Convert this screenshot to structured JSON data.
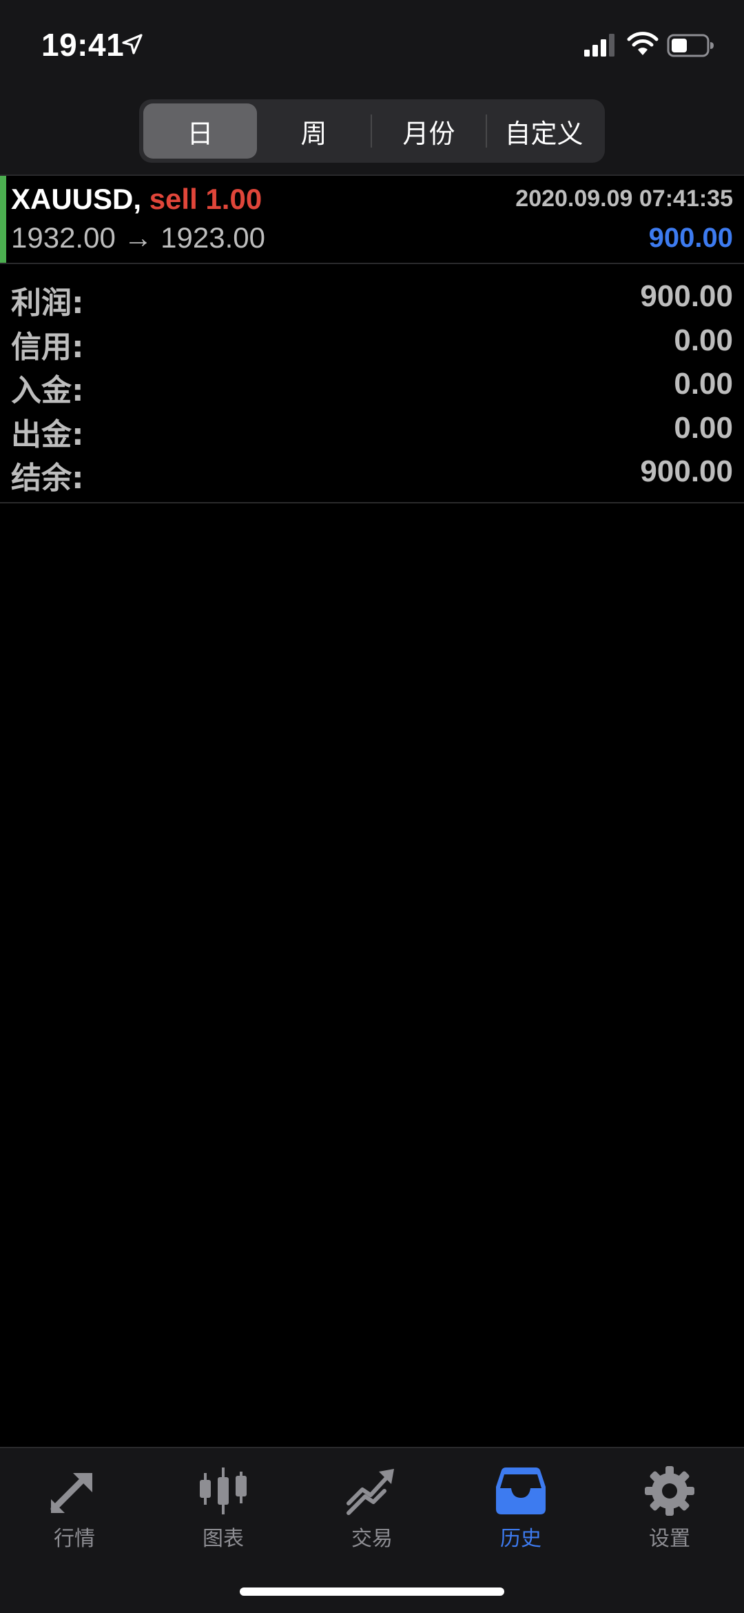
{
  "status_bar": {
    "time": "19:41",
    "icons": [
      "location-arrow-icon",
      "cellular-signal-icon",
      "wifi-icon",
      "battery-icon"
    ]
  },
  "period_selector": {
    "segments": [
      {
        "label": "日",
        "selected": true
      },
      {
        "label": "周",
        "selected": false
      },
      {
        "label": "月份",
        "selected": false
      },
      {
        "label": "自定义",
        "selected": false
      }
    ]
  },
  "trade": {
    "symbol": "XAUUSD,",
    "side": "sell 1.00",
    "time": "2020.09.09 07:41:35",
    "prices": "1932.00 → 1923.00",
    "profit": "900.00"
  },
  "summary": [
    {
      "label": "利润:",
      "value": "900.00"
    },
    {
      "label": "信用:",
      "value": "0.00"
    },
    {
      "label": "入金:",
      "value": "0.00"
    },
    {
      "label": "出金:",
      "value": "0.00"
    },
    {
      "label": "结余:",
      "value": "900.00"
    }
  ],
  "tab_bar": {
    "tabs": [
      {
        "label": "行情",
        "icon": "quotes-arrows-icon",
        "active": false
      },
      {
        "label": "图表",
        "icon": "candlestick-chart-icon",
        "active": false
      },
      {
        "label": "交易",
        "icon": "trade-trend-icon",
        "active": false
      },
      {
        "label": "历史",
        "icon": "history-inbox-icon",
        "active": true
      },
      {
        "label": "设置",
        "icon": "gear-icon",
        "active": false
      }
    ]
  },
  "colors": {
    "accent_blue": "#3d7bf0",
    "sell_red": "#e0463a",
    "trade_indicator_green": "#4caf50",
    "text_gray": "#bdbdbd",
    "background": "#000000"
  }
}
